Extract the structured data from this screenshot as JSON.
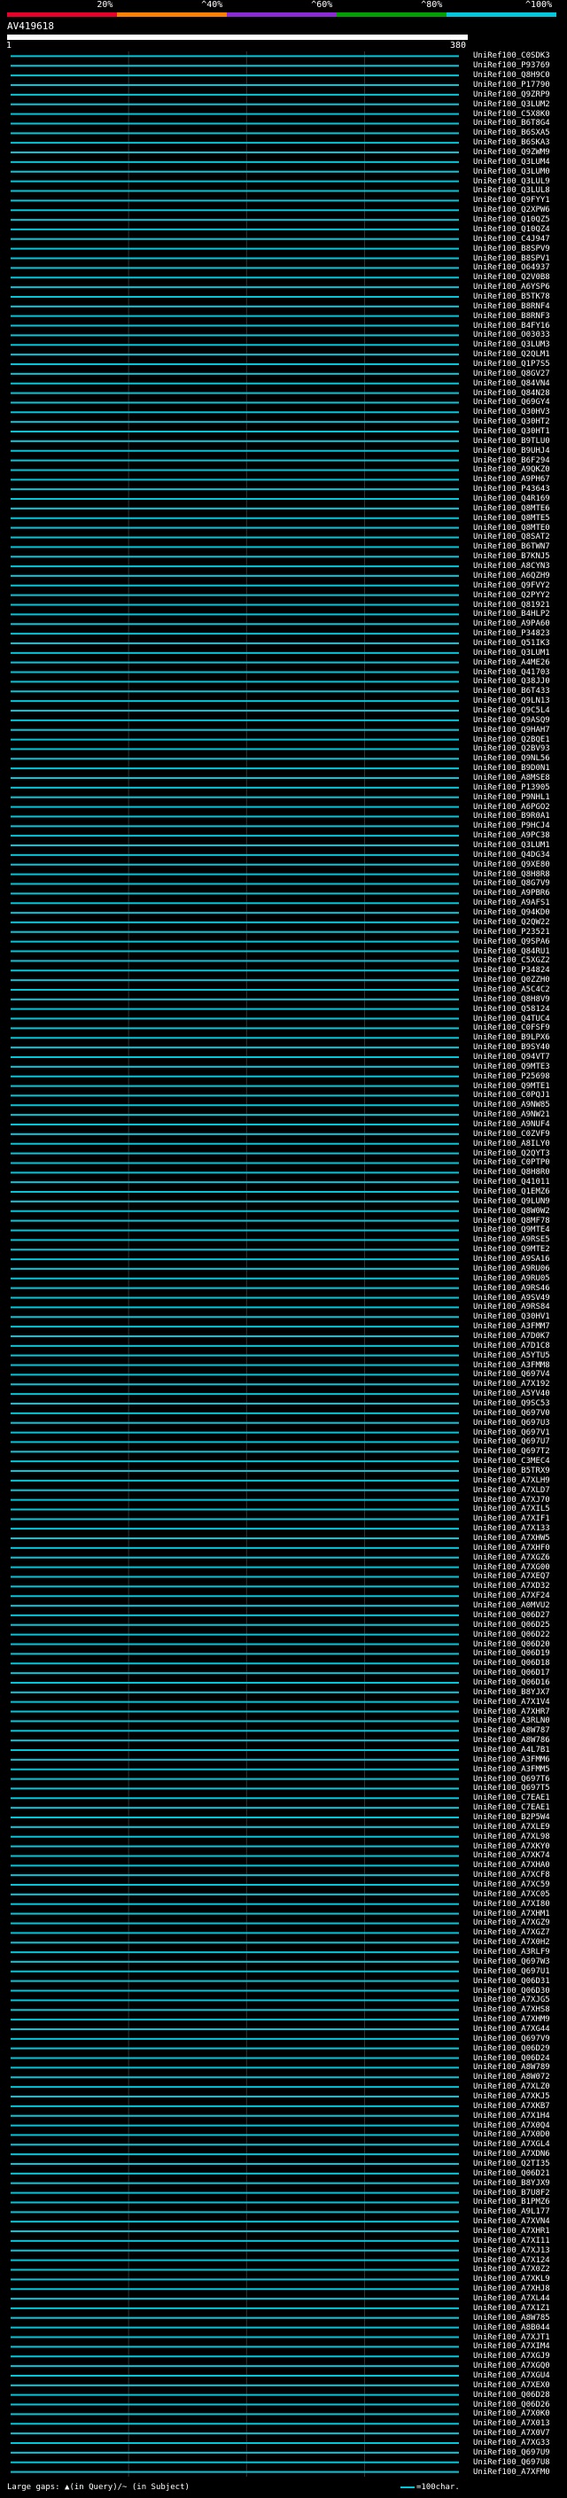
{
  "header": {
    "query_id": "AV419618",
    "range_start": "1",
    "range_end": "380",
    "identity_scale": [
      {
        "label": "20%",
        "color": "#e8002a"
      },
      {
        "label": "^40%",
        "color": "#ff7f00"
      },
      {
        "label": "^60%",
        "color": "#8c2bd6"
      },
      {
        "label": "^80%",
        "color": "#00a000"
      },
      {
        "label": "^100%",
        "color": "#00c8dc"
      }
    ]
  },
  "hit_color": "#00c8dc",
  "hits": [
    "UniRef100_C0SDK3",
    "UniRef100_P93769",
    "UniRef100_Q8H9C0",
    "UniRef100_P17790",
    "UniRef100_Q9ZRP9",
    "UniRef100_Q3LUM2",
    "UniRef100_C5X8K0",
    "UniRef100_B6T8G4",
    "UniRef100_B6SXA5",
    "UniRef100_B6SKA3",
    "UniRef100_Q9ZWM9",
    "UniRef100_Q3LUM4",
    "UniRef100_Q3LUM0",
    "UniRef100_Q3LUL9",
    "UniRef100_Q3LUL8",
    "UniRef100_Q9FYY1",
    "UniRef100_Q2XPW6",
    "UniRef100_Q10QZ5",
    "UniRef100_Q10QZ4",
    "UniRef100_C4J947",
    "UniRef100_B8SPV9",
    "UniRef100_B8SPV1",
    "UniRef100_O64937",
    "UniRef100_Q2V0B8",
    "UniRef100_A6YSP6",
    "UniRef100_B5TK78",
    "UniRef100_B8RNF4",
    "UniRef100_B8RNF3",
    "UniRef100_B4FY16",
    "UniRef100_O03033",
    "UniRef100_Q3LUM3",
    "UniRef100_Q2QLM1",
    "UniRef100_Q1P7S5",
    "UniRef100_Q8GV27",
    "UniRef100_Q84VN4",
    "UniRef100_Q84N28",
    "UniRef100_Q69GY4",
    "UniRef100_Q30HV3",
    "UniRef100_Q30HT2",
    "UniRef100_Q30HT1",
    "UniRef100_B9TLU0",
    "UniRef100_B9UHJ4",
    "UniRef100_B6F294",
    "UniRef100_A9QKZ0",
    "UniRef100_A9PH67",
    "UniRef100_P43643",
    "UniRef100_Q4R169",
    "UniRef100_Q8MTE6",
    "UniRef100_Q8MTE5",
    "UniRef100_Q8MTE0",
    "UniRef100_Q8SAT2",
    "UniRef100_B6TWN7",
    "UniRef100_B7KNJ5",
    "UniRef100_A8CYN3",
    "UniRef100_A6QZH9",
    "UniRef100_Q9FVY2",
    "UniRef100_Q2PYY2",
    "UniRef100_Q81921",
    "UniRef100_B4HLP2",
    "UniRef100_A9PA60",
    "UniRef100_P34823",
    "UniRef100_Q51IK3",
    "UniRef100_Q3LUM1",
    "UniRef100_A4ME26",
    "UniRef100_Q41703",
    "UniRef100_Q38JJ0",
    "UniRef100_B6T433",
    "UniRef100_Q9LN13",
    "UniRef100_Q9C5L4",
    "UniRef100_Q9ASQ9",
    "UniRef100_Q9HAH7",
    "UniRef100_Q2BQE1",
    "UniRef100_Q2BV93",
    "UniRef100_Q9NL56",
    "UniRef100_B9D0N1",
    "UniRef100_A8MSE8",
    "UniRef100_P13905",
    "UniRef100_P9NHL1",
    "UniRef100_A6PGO2",
    "UniRef100_B9R0A1",
    "UniRef100_P9HCJ4",
    "UniRef100_A9PC38",
    "UniRef100_Q3LUM1",
    "UniRef100_Q4DG34",
    "UniRef100_Q9XE80",
    "UniRef100_Q8H8R8",
    "UniRef100_Q8G7V9",
    "UniRef100_A9PBR6",
    "UniRef100_A9AFS1",
    "UniRef100_Q94KD0",
    "UniRef100_Q2QW22",
    "UniRef100_P23521",
    "UniRef100_Q9SPA6",
    "UniRef100_Q84RU1",
    "UniRef100_C5XGZ2",
    "UniRef100_P34824",
    "UniRef100_Q0ZZH0",
    "UniRef100_A5C4C2",
    "UniRef100_Q8H8V9",
    "UniRef100_Q58124",
    "UniRef100_Q4TUC4",
    "UniRef100_C0FSF9",
    "UniRef100_B9LPX6",
    "UniRef100_B9SY40",
    "UniRef100_Q94VT7",
    "UniRef100_Q9MTE3",
    "UniRef100_P25698",
    "UniRef100_Q9MTE1",
    "UniRef100_C0PQJ1",
    "UniRef100_A9NW85",
    "UniRef100_A9NW21",
    "UniRef100_A9NUF4",
    "UniRef100_C0ZVF9",
    "UniRef100_A8ILY0",
    "UniRef100_Q2QYT3",
    "UniRef100_C0PTP0",
    "UniRef100_Q8H8R0",
    "UniRef100_Q41011",
    "UniRef100_Q1EMZ6",
    "UniRef100_Q9LUN9",
    "UniRef100_Q8W0W2",
    "UniRef100_Q8MF78",
    "UniRef100_Q9MTE4",
    "UniRef100_A9RSE5",
    "UniRef100_Q9MTE2",
    "UniRef100_A9SA16",
    "UniRef100_A9RU06",
    "UniRef100_A9RU05",
    "UniRef100_A9RS46",
    "UniRef100_A9SV49",
    "UniRef100_A9RS84",
    "UniRef100_Q30HV1",
    "UniRef100_A3FMM7",
    "UniRef100_A7D0K7",
    "UniRef100_A7D1C8",
    "UniRef100_A5YTU5",
    "UniRef100_A3FMM8",
    "UniRef100_Q697V4",
    "UniRef100_A7X192",
    "UniRef100_A5YV40",
    "UniRef100_Q9SC53",
    "UniRef100_Q697V0",
    "UniRef100_Q697U3",
    "UniRef100_Q697V1",
    "UniRef100_Q697U7",
    "UniRef100_Q697T2",
    "UniRef100_C3MEC4",
    "UniRef100_B5TRX9",
    "UniRef100_A7XLH9",
    "UniRef100_A7XLD7",
    "UniRef100_A7XJ70",
    "UniRef100_A7XIL5",
    "UniRef100_A7XIF1",
    "UniRef100_A7X133",
    "UniRef100_A7XHW5",
    "UniRef100_A7XHF0",
    "UniRef100_A7XGZ6",
    "UniRef100_A7XG00",
    "UniRef100_A7XEQ7",
    "UniRef100_A7XD32",
    "UniRef100_A7XF24",
    "UniRef100_A0MVU2",
    "UniRef100_Q06D27",
    "UniRef100_Q06D25",
    "UniRef100_Q06D22",
    "UniRef100_Q06D20",
    "UniRef100_Q06D19",
    "UniRef100_Q06D18",
    "UniRef100_Q06D17",
    "UniRef100_Q06D16",
    "UniRef100_B8YJX7",
    "UniRef100_A7X1V4",
    "UniRef100_A7XHR7",
    "UniRef100_A3RLN0",
    "UniRef100_A8W787",
    "UniRef100_A8W786",
    "UniRef100_A4L7B1",
    "UniRef100_A3FMM6",
    "UniRef100_A3FMM5",
    "UniRef100_Q697T6",
    "UniRef100_Q697T5",
    "UniRef100_C7EAE1",
    "UniRef100_C7EAE1",
    "UniRef100_B2P5W4",
    "UniRef100_A7XLE9",
    "UniRef100_A7XL98",
    "UniRef100_A7XKY0",
    "UniRef100_A7XK74",
    "UniRef100_A7XHA0",
    "UniRef100_A7XCF8",
    "UniRef100_A7XC59",
    "UniRef100_A7XC05",
    "UniRef100_A7XI80",
    "UniRef100_A7XHM1",
    "UniRef100_A7XGZ9",
    "UniRef100_A7XGZ7",
    "UniRef100_A7X0H2",
    "UniRef100_A3RLF9",
    "UniRef100_Q697W3",
    "UniRef100_Q697U1",
    "UniRef100_Q06D31",
    "UniRef100_Q06D30",
    "UniRef100_A7XJG5",
    "UniRef100_A7XHS8",
    "UniRef100_A7XHM9",
    "UniRef100_A7XG44",
    "UniRef100_Q697V9",
    "UniRef100_Q06D29",
    "UniRef100_Q06D24",
    "UniRef100_A8W789",
    "UniRef100_A8W072",
    "UniRef100_A7XLZ0",
    "UniRef100_A7XKJ5",
    "UniRef100_A7XKB7",
    "UniRef100_A7X1H4",
    "UniRef100_A7X0Q4",
    "UniRef100_A7X0D0",
    "UniRef100_A7XGL4",
    "UniRef100_A7XDN6",
    "UniRef100_Q2TI35",
    "UniRef100_Q06D21",
    "UniRef100_B8YJX9",
    "UniRef100_B7U8F2",
    "UniRef100_B1PMZ6",
    "UniRef100_A9L177",
    "UniRef100_A7XVN4",
    "UniRef100_A7XHR1",
    "UniRef100_A7XI11",
    "UniRef100_A7XJ13",
    "UniRef100_A7X124",
    "UniRef100_A7X0Z2",
    "UniRef100_A7XKL9",
    "UniRef100_A7XHJ8",
    "UniRef100_A7XL44",
    "UniRef100_A7X1Z1",
    "UniRef100_A8W785",
    "UniRef100_A8B044",
    "UniRef100_A7XJT1",
    "UniRef100_A7XIM4",
    "UniRef100_A7XGJ9",
    "UniRef100_A7XGQ0",
    "UniRef100_A7XGU4",
    "UniRef100_A7XEX0",
    "UniRef100_Q06D28",
    "UniRef100_Q06D26",
    "UniRef100_A7X0K0",
    "UniRef100_A7X013",
    "UniRef100_A7X0V7",
    "UniRef100_A7XG33",
    "UniRef100_Q697U9",
    "UniRef100_Q697U8",
    "UniRef100_A7XFM0"
  ],
  "legend": {
    "gaps_text": "Large gaps: ▲(in Query)/~ (in Subject)",
    "scale_text": "=100char."
  }
}
